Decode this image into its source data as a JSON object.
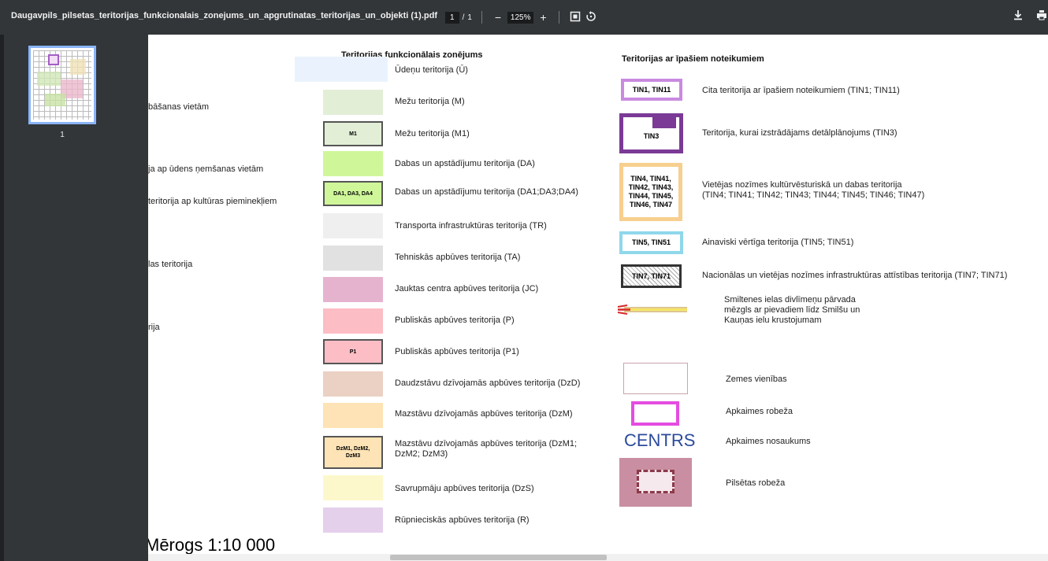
{
  "toolbar": {
    "title": "Daugavpils_pilsetas_teritorijas_funkcionalais_zonejums_un_apgrutinatas_teritorijas_un_objekti (1).pdf",
    "page_current": "1",
    "page_sep": "/",
    "page_total": "1",
    "zoom_out": "−",
    "zoom": "125%",
    "zoom_in": "+",
    "fit_icon": "fit-page-icon",
    "rotate_icon": "rotate-icon",
    "download_icon": "download-icon",
    "print_icon": "print-icon"
  },
  "sidebar": {
    "thumb_label": "1"
  },
  "left_fragments": [
    "bāšanas vietām",
    "ja ap ūdens ņemšanas vietām",
    "teritorija ap kultūras pieminekļiem",
    "las teritorija",
    "rija"
  ],
  "zoning": {
    "heading": "Teritorijas funkcionālais zonējums",
    "items": [
      {
        "code": "",
        "label": "Ūdeņu teritorija (Ū)",
        "color": "#eaf3fd"
      },
      {
        "code": "",
        "label": "Mežu teritorija (M)",
        "color": "#e2eed6"
      },
      {
        "code": "M1",
        "label": "Mežu teritorija (M1)",
        "color": "#e2eed6"
      },
      {
        "code": "",
        "label": "Dabas un apstādījumu teritorija (DA)",
        "color": "#cff79a"
      },
      {
        "code": "DA1, DA3, DA4",
        "label": "Dabas un apstādījumu teritorija (DA1;DA3;DA4)",
        "color": "#cff79a"
      },
      {
        "code": "",
        "label": "Transporta infrastruktūras teritorija (TR)",
        "color": "#efefef"
      },
      {
        "code": "",
        "label": "Tehniskās apbūves teritorija (TA)",
        "color": "#e1e1e1"
      },
      {
        "code": "",
        "label": "Jauktas centra apbūves teritorija (JC)",
        "color": "#e6b3cf"
      },
      {
        "code": "",
        "label": "Publiskās apbūves teritorija (P)",
        "color": "#fdbdc5"
      },
      {
        "code": "P1",
        "label": "Publiskās apbūves teritorija (P1)",
        "color": "#fdbdc5"
      },
      {
        "code": "",
        "label": "Daudzstāvu dzīvojamās apbūves teritorija (DzD)",
        "color": "#ebd0c4"
      },
      {
        "code": "",
        "label": "Mazstāvu dzīvojamās apbūves teritorija (DzM)",
        "color": "#fde3b5"
      },
      {
        "code": "DzM1, DzM2, DzM3",
        "label": "Mazstāvu dzīvojamās apbūves teritorija (DzM1; DzM2; DzM3)",
        "color": "#fde3b5"
      },
      {
        "code": "",
        "label": "Savrupmāju apbūves teritorija (DzS)",
        "color": "#fdf8cc"
      },
      {
        "code": "",
        "label": "Rūpnieciskās apbūves teritorija (R)",
        "color": "#e5d0ec"
      }
    ]
  },
  "special": {
    "heading": "Teritorijas ar īpašiem noteikumiem",
    "tin1": {
      "code": "TIN1, TIN11",
      "label": "Cita teritorija ar īpašiem noteikumiem (TIN1; TIN11)",
      "color": "#c98ae0"
    },
    "tin3": {
      "code": "TIN3",
      "label": "Teritorija, kurai izstrādājams detālplānojums (TIN3)",
      "color": "#7a3a96"
    },
    "tin4": {
      "code": "TIN4, TIN41, TIN42, TIN43, TIN44, TIN45, TIN46, TIN47",
      "label_line1": "Vietējas nozīmes kultūrvēsturiskā un dabas teritorija",
      "label_line2": "(TIN4; TIN41; TIN42; TIN43; TIN44; TIN45; TIN46; TIN47)",
      "color": "#f7cf8e"
    },
    "tin5": {
      "code": "TIN5, TIN51",
      "label": "Ainaviski vērtīga teritorija (TIN5; TIN51)",
      "color": "#8fd7ea"
    },
    "tin7": {
      "code": "TIN7, TIN71",
      "label": "Nacionālas un vietējas nozīmes infrastruktūras attīstības teritorija (TIN7; TIN71)",
      "color": "#333333"
    },
    "overpass": {
      "line1": "Smiltenes ielas divlīmeņu pārvada",
      "line2": "mēzgls ar pievadiem līdz Smilšu un",
      "line3": "Kauņas ielu krustojumam"
    },
    "land_units": {
      "label": "Zemes vienības",
      "color": "#c9a4ae"
    },
    "neighborhood_border": {
      "label": "Apkaimes robeža",
      "color": "#e44ce0"
    },
    "neighborhood_name": {
      "sample": "CENTRS",
      "label": "Apkaimes nosaukums",
      "color": "#2b4a9c"
    },
    "city_border": {
      "label": "Pilsētas robeža",
      "color": "#c98ea2"
    }
  },
  "scale": "Mērogs 1:10 000"
}
